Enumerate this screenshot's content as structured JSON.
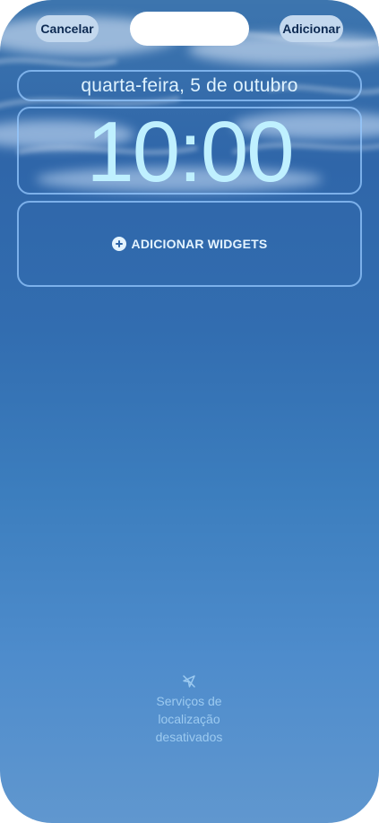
{
  "header": {
    "cancel_label": "Cancelar",
    "add_label": "Adicionar"
  },
  "lock_screen": {
    "date": "quarta-feira, 5 de outubro",
    "time": "10:00",
    "add_widgets_label": "ADICIONAR WIDGETS"
  },
  "location_notice": {
    "icon": "location-off-icon",
    "line1": "Serviços de",
    "line2": "localização",
    "line3": "desativados"
  },
  "colors": {
    "accent_button_bg": "#c3d8ee",
    "accent_button_text": "#0d2a52",
    "wallpaper_top": "#3d75ae",
    "wallpaper_bottom": "#6097cf",
    "clock_text": "#bff0ff"
  }
}
